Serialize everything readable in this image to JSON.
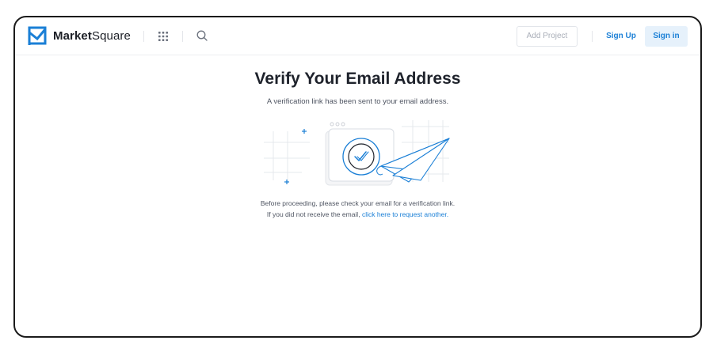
{
  "header": {
    "logo_bold": "Market",
    "logo_regular": "Square",
    "add_project_label": "Add Project",
    "sign_up_label": "Sign Up",
    "sign_in_label": "Sign in"
  },
  "main": {
    "title": "Verify Your Email Address",
    "subtitle": "A verification link has been sent to your email address.",
    "instruction": "Before proceeding, please check your email for a verification link.",
    "resend_prefix": "If you did not receive the email,",
    "resend_link": "click here to request another."
  },
  "icons": [
    "logo-mark-icon",
    "apps-grid-icon",
    "search-icon",
    "verification-illustration"
  ],
  "colors": {
    "accent": "#1a7fd6",
    "brand_logo": "#1a7fd6",
    "sign_in_bg": "#e6f1fb",
    "text_dark": "#1e222b",
    "text_muted": "#4f5562"
  }
}
